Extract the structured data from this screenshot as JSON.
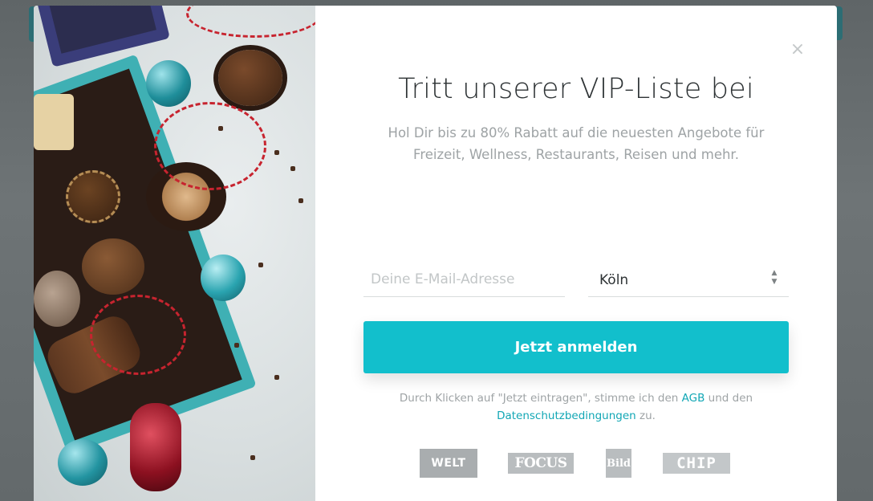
{
  "modal": {
    "close_symbol": "×",
    "title": "Tritt unserer VIP-Liste bei",
    "subtitle": "Hol Dir bis zu 80% Rabatt auf die neuesten Angebote für Freizeit, Wellness, Restaurants, Reisen und mehr.",
    "email": {
      "placeholder": "Deine E-Mail-Adresse",
      "value": ""
    },
    "city_select": {
      "value": "Köln",
      "arrow_up": "▲",
      "arrow_down": "▼"
    },
    "submit_label": "Jetzt anmelden",
    "legal": {
      "prefix": "Durch Klicken auf \"Jetzt eintragen\", stimme ich den ",
      "agb_link": "AGB",
      "middle": " und den ",
      "privacy_link": "Datenschutzbedingungen",
      "suffix": " zu."
    },
    "press_logos": [
      "WELT",
      "FOCUS",
      "Bild",
      "CHIP"
    ]
  },
  "colors": {
    "accent": "#12bfcc",
    "link": "#12a7b5",
    "title": "#2e3335",
    "muted_text": "#9ea3a5",
    "overlay": "#6b7073"
  },
  "icons": {
    "close": "close-icon",
    "select_arrows": "sort-arrows-icon"
  }
}
